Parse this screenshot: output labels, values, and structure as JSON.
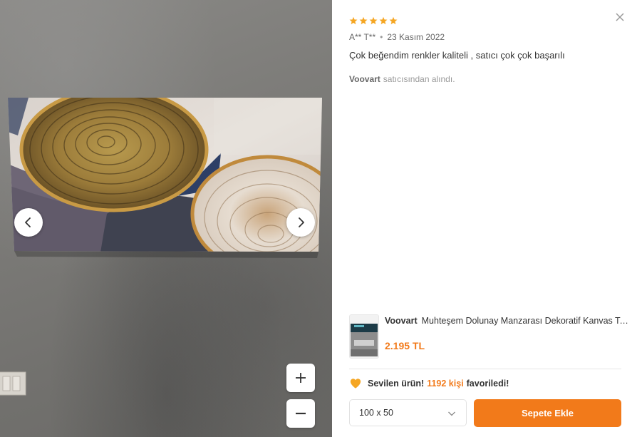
{
  "review": {
    "rating": 5,
    "author": "A** T**",
    "date": "23 Kasım 2022",
    "text": "Çok beğendim renkler kaliteli , satıcı çok çok başarılı",
    "seller_name": "Voovart",
    "seller_suffix": "satıcısından alındı."
  },
  "product": {
    "brand": "Voovart",
    "title": "Muhteşem Dolunay Manzarası Dekoratif Kanvas Tablo",
    "price": "2.195 TL"
  },
  "favorite": {
    "label": "Sevilen ürün!",
    "count": "1192 kişi",
    "suffix": "favoriledi!"
  },
  "size_select": {
    "value": "100 x 50"
  },
  "cart_button": {
    "label": "Sepete Ekle"
  },
  "colors": {
    "accent": "#f27a1a",
    "star": "#f5a623"
  },
  "icons": {
    "close": "close-icon",
    "prev": "chevron-left-icon",
    "next": "chevron-right-icon",
    "zoom_in": "plus-icon",
    "zoom_out": "minus-icon",
    "heart": "heart-icon",
    "dropdown": "chevron-down-icon",
    "star": "star-icon"
  }
}
